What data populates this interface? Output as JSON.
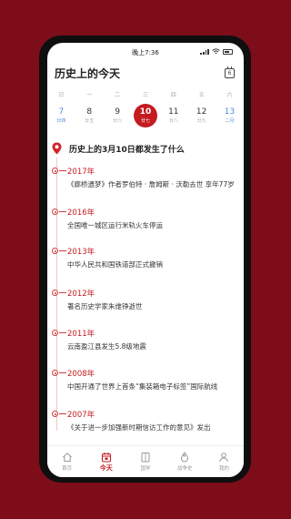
{
  "status": {
    "time": "晚上7:36"
  },
  "header": {
    "title": "历史上的今天",
    "calendar_icon": "calendar-icon"
  },
  "week": {
    "weekdays": [
      "日",
      "一",
      "二",
      "三",
      "四",
      "五",
      "六"
    ],
    "days": [
      {
        "num": "7",
        "sub": "廿四"
      },
      {
        "num": "8",
        "sub": "廿五"
      },
      {
        "num": "9",
        "sub": "廿六"
      },
      {
        "num": "10",
        "sub": "廿七"
      },
      {
        "num": "11",
        "sub": "廿八"
      },
      {
        "num": "12",
        "sub": "廿九"
      },
      {
        "num": "13",
        "sub": "二月"
      }
    ],
    "selected_index": 3
  },
  "section": {
    "title": "历史上的3月10日都发生了什么"
  },
  "events": [
    {
      "year": "2017年",
      "desc": "《廊桥遗梦》作者罗伯特 · 詹姆斯 · 沃勒去世  享年77岁"
    },
    {
      "year": "2016年",
      "desc": "全国唯一城区运行米轨火车停运"
    },
    {
      "year": "2013年",
      "desc": "中华人民共和国铁道部正式撤销"
    },
    {
      "year": "2012年",
      "desc": "著名历史学家朱维铮逝世"
    },
    {
      "year": "2011年",
      "desc": "云南盈江县发生5.8级地震"
    },
    {
      "year": "2008年",
      "desc": "中国开通了世界上首条“集装箱电子标签”国际航线"
    },
    {
      "year": "2007年",
      "desc": "《关于进一步加强新时期信访工作的意见》发出"
    }
  ],
  "tabs": [
    {
      "label": "首页",
      "icon": "home-icon"
    },
    {
      "label": "今天",
      "icon": "calendar-icon"
    },
    {
      "label": "国学",
      "icon": "book-icon"
    },
    {
      "label": "战争史",
      "icon": "flame-icon"
    },
    {
      "label": "我的",
      "icon": "person-icon"
    }
  ],
  "colors": {
    "accent": "#c41b20",
    "background": "#7e0d1a",
    "today_blue": "#4f8fd8"
  }
}
